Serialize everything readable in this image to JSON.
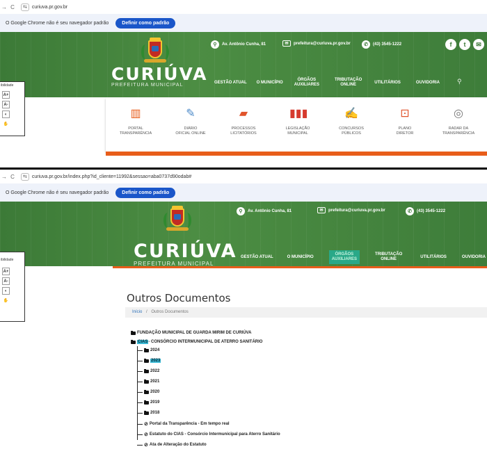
{
  "screen1": {
    "browser": {
      "url": "curiuva.pr.gov.br",
      "info_message": "O Google Chrome não é seu navegador padrão",
      "default_button": "Definir como padrão"
    },
    "header": {
      "brand_name": "CURIÚVA",
      "brand_sub": "PREFEITURA MUNICIPAL",
      "address": "Av. Antônio Cunha, 81",
      "email": "prefeitura@curiuva.pr.gov.br",
      "phone": "(43) 3545-1222",
      "social": [
        "f",
        "t",
        "✉"
      ],
      "menu": [
        "GESTÃO ATUAL",
        "O MUNICÍPIO",
        "ÓRGÃOS\nAUXILIARES",
        "TRIBUTAÇÃO\nONLINE",
        "UTILITÁRIOS",
        "OUVIDORIA"
      ]
    },
    "accessibility_label": "ibilidade",
    "quick_links": [
      {
        "label": "PORTAL\nTRANSPARÊNCIA",
        "icon": "bar-chart-icon"
      },
      {
        "label": "DIÁRIO\nOFICIAL ONLINE",
        "icon": "edit-document-icon"
      },
      {
        "label": "PROCESSOS\nLICITATÓRIOS",
        "icon": "folder-icon"
      },
      {
        "label": "LEGISLAÇÃO\nMUNICIPAL",
        "icon": "binders-icon"
      },
      {
        "label": "CONCURSOS\nPÚBLICOS",
        "icon": "clipboard-icon"
      },
      {
        "label": "PLANO\nDIRETOR",
        "icon": "plan-icon"
      },
      {
        "label": "RADAR DA\nTRANSPARÊNCIA",
        "icon": "radar-icon"
      }
    ]
  },
  "screen2": {
    "browser": {
      "url": "curiuva.pr.gov.br/index.php?id_cliente=11992&sessao=aba0737d90odab#",
      "info_message": "O Google Chrome não é seu navegador padrão",
      "default_button": "Definir como padrão"
    },
    "header": {
      "brand_name": "CURIÚVA",
      "brand_sub": "PREFEITURA MUNICIPAL",
      "address": "Av. Antônio Cunha, 81",
      "email": "prefeitura@curiuva.pr.gov.br",
      "phone": "(43) 3545-1222",
      "menu": [
        "GESTÃO ATUAL",
        "O MUNICÍPIO",
        "ÓRGÃOS\nAUXILIARES",
        "TRIBUTAÇÃO\nONLINE",
        "UTILITÁRIOS",
        "OUVIDORIA"
      ],
      "active_menu": "ÓRGÃOS\nAUXILIARES"
    },
    "accessibility_label": "ibilidade",
    "page_title": "Outros Documentos",
    "breadcrumb": {
      "home": "Início",
      "separator": "/",
      "current": "Outros Documentos"
    },
    "tree": {
      "root1": "FUNDAÇÃO MUNICIPAL DE GUARDA MIRIM DE CURIÚVA",
      "root2_highlight": "CIAS",
      "root2_rest": " - CONSÓRCIO INTERMUNICIPAL DE ATERRO SANITÁRIO",
      "years": [
        "2024",
        "2023",
        "2022",
        "2021",
        "2020",
        "2019",
        "2018"
      ],
      "selected_year": "2023",
      "links": [
        "Portal da Transparência - Em tempo real",
        "Estatuto do CIAS - Consórcio Intermunicipal para Aterro Sanitário",
        "Ata de Alteração do Estatuto"
      ]
    }
  }
}
